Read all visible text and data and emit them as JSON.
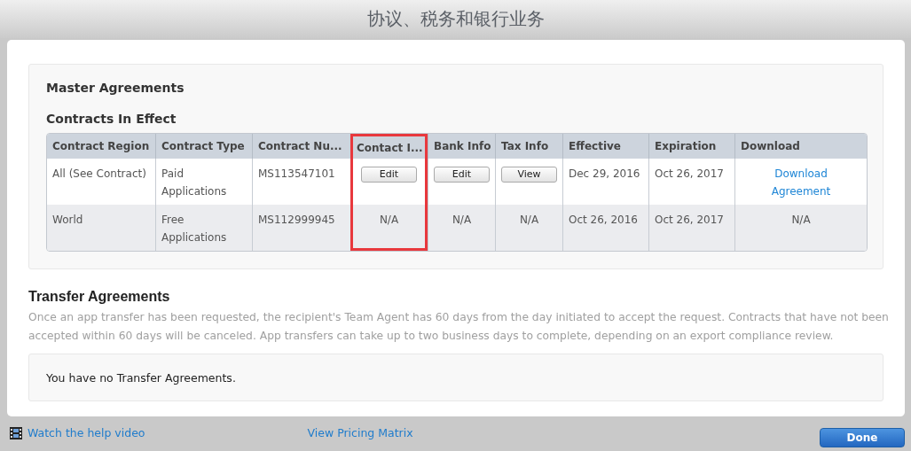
{
  "window": {
    "title": "协议、税务和银行业务"
  },
  "master": {
    "heading": "Master Agreements",
    "subheading": "Contracts In Effect",
    "columns": [
      {
        "label": "Contract Region",
        "highlighted": false
      },
      {
        "label": "Contract Type",
        "highlighted": false
      },
      {
        "label": "Contract Nu...",
        "highlighted": false
      },
      {
        "label": "Contact I...",
        "highlighted": true
      },
      {
        "label": "Bank Info",
        "highlighted": false
      },
      {
        "label": "Tax Info",
        "highlighted": false
      },
      {
        "label": "Effective",
        "highlighted": false
      },
      {
        "label": "Expiration",
        "highlighted": false
      },
      {
        "label": "Download",
        "highlighted": false
      }
    ],
    "rows": [
      {
        "cells": [
          {
            "kind": "text",
            "text": "All (See Contract)"
          },
          {
            "kind": "text",
            "text": "Paid Applications"
          },
          {
            "kind": "text",
            "text": "MS113547101"
          },
          {
            "kind": "button",
            "text": "Edit"
          },
          {
            "kind": "button",
            "text": "Edit"
          },
          {
            "kind": "button",
            "text": "View"
          },
          {
            "kind": "text",
            "text": "Dec 29, 2016"
          },
          {
            "kind": "text",
            "text": "Oct 26, 2017"
          },
          {
            "kind": "link",
            "text": "Download Agreement"
          }
        ]
      },
      {
        "cells": [
          {
            "kind": "text",
            "text": "World"
          },
          {
            "kind": "text",
            "text": "Free Applications"
          },
          {
            "kind": "text",
            "text": "MS112999945"
          },
          {
            "kind": "na",
            "text": "N/A"
          },
          {
            "kind": "na",
            "text": "N/A"
          },
          {
            "kind": "na",
            "text": "N/A"
          },
          {
            "kind": "text",
            "text": "Oct 26, 2016"
          },
          {
            "kind": "text",
            "text": "Oct 26, 2017"
          },
          {
            "kind": "na",
            "text": "N/A"
          }
        ]
      }
    ]
  },
  "transfer": {
    "heading": "Transfer Agreements",
    "description": "Once an app transfer has been requested, the recipient's Team Agent has 60 days from the day initiated to accept the request. Contracts that have not been accepted within 60 days will be canceled. App transfers can take up to two business days to complete, depending on an export compliance review.",
    "empty_message": "You have no Transfer Agreements."
  },
  "footer": {
    "help_link": "Watch the help video",
    "pricing_link": "View Pricing Matrix",
    "done_button": "Done"
  }
}
